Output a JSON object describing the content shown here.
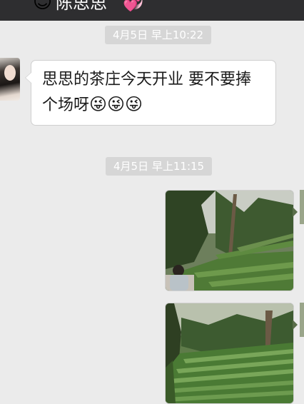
{
  "header": {
    "title": "陈思思",
    "emoji": "😊",
    "sticker": "💞"
  },
  "messages": [
    {
      "timestamp": "4月5日 早上10:22",
      "sender": "contact",
      "text": "思思的茶庄今天开业 要不要捧个场呀",
      "emojis": "😜😜😜"
    },
    {
      "timestamp": "4月5日 早上11:15",
      "sender": "me",
      "photos": [
        {
          "description": "tea-plantation-photo"
        },
        {
          "description": "tea-terraces-photo"
        }
      ]
    }
  ],
  "colors": {
    "chat_background": "#ebebeb",
    "header_background": "#2e2e30",
    "bubble_background": "#ffffff",
    "timestamp_background": "#d6d6d6"
  }
}
